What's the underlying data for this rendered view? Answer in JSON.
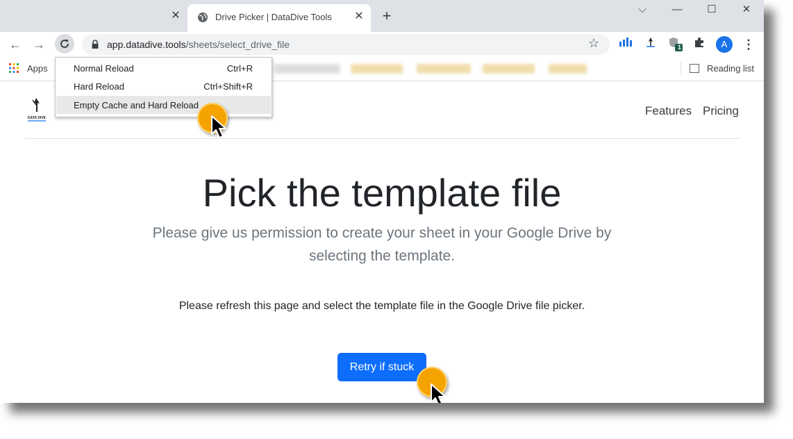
{
  "browser": {
    "tabs": [
      {
        "title": "Drive Picker | DataDive Tools",
        "active": true
      }
    ],
    "prev_tab_close": "✕",
    "tab_close": "✕",
    "new_tab": "+",
    "window_controls": {
      "menu": "⌵",
      "minimize": "—",
      "maximize": "☐",
      "close": "✕"
    },
    "nav": {
      "back": "←",
      "forward": "→",
      "reload": "C"
    },
    "address": {
      "host": "app.datadive.tools",
      "path": "/sheets/select_drive_file"
    },
    "profile_initial": "A",
    "extension_badge": "1",
    "bookmarks": {
      "apps_label": "Apps",
      "reading_list_label": "Reading list"
    }
  },
  "reload_menu": {
    "items": [
      {
        "label": "Normal Reload",
        "shortcut": "Ctrl+R",
        "highlighted": false
      },
      {
        "label": "Hard Reload",
        "shortcut": "Ctrl+Shift+R",
        "highlighted": false
      },
      {
        "label": "Empty Cache and Hard Reload",
        "shortcut": "",
        "highlighted": true
      }
    ]
  },
  "page": {
    "brand": "DataDive",
    "logo_caption": "DATA DIVE",
    "nav": {
      "features": "Features",
      "pricing": "Pricing"
    },
    "headline": "Pick the template file",
    "lead": "Please give us permission to create your sheet in your Google Drive by selecting the template.",
    "instruction": "Please refresh this page and select the template file in the Google Drive file picker.",
    "retry_button": "Retry if stuck"
  },
  "colors": {
    "primary_button": "#0d6efd",
    "cursor_highlight": "#f5a300",
    "tab_strip": "#dee1e6",
    "profile": "#1a73e8"
  }
}
